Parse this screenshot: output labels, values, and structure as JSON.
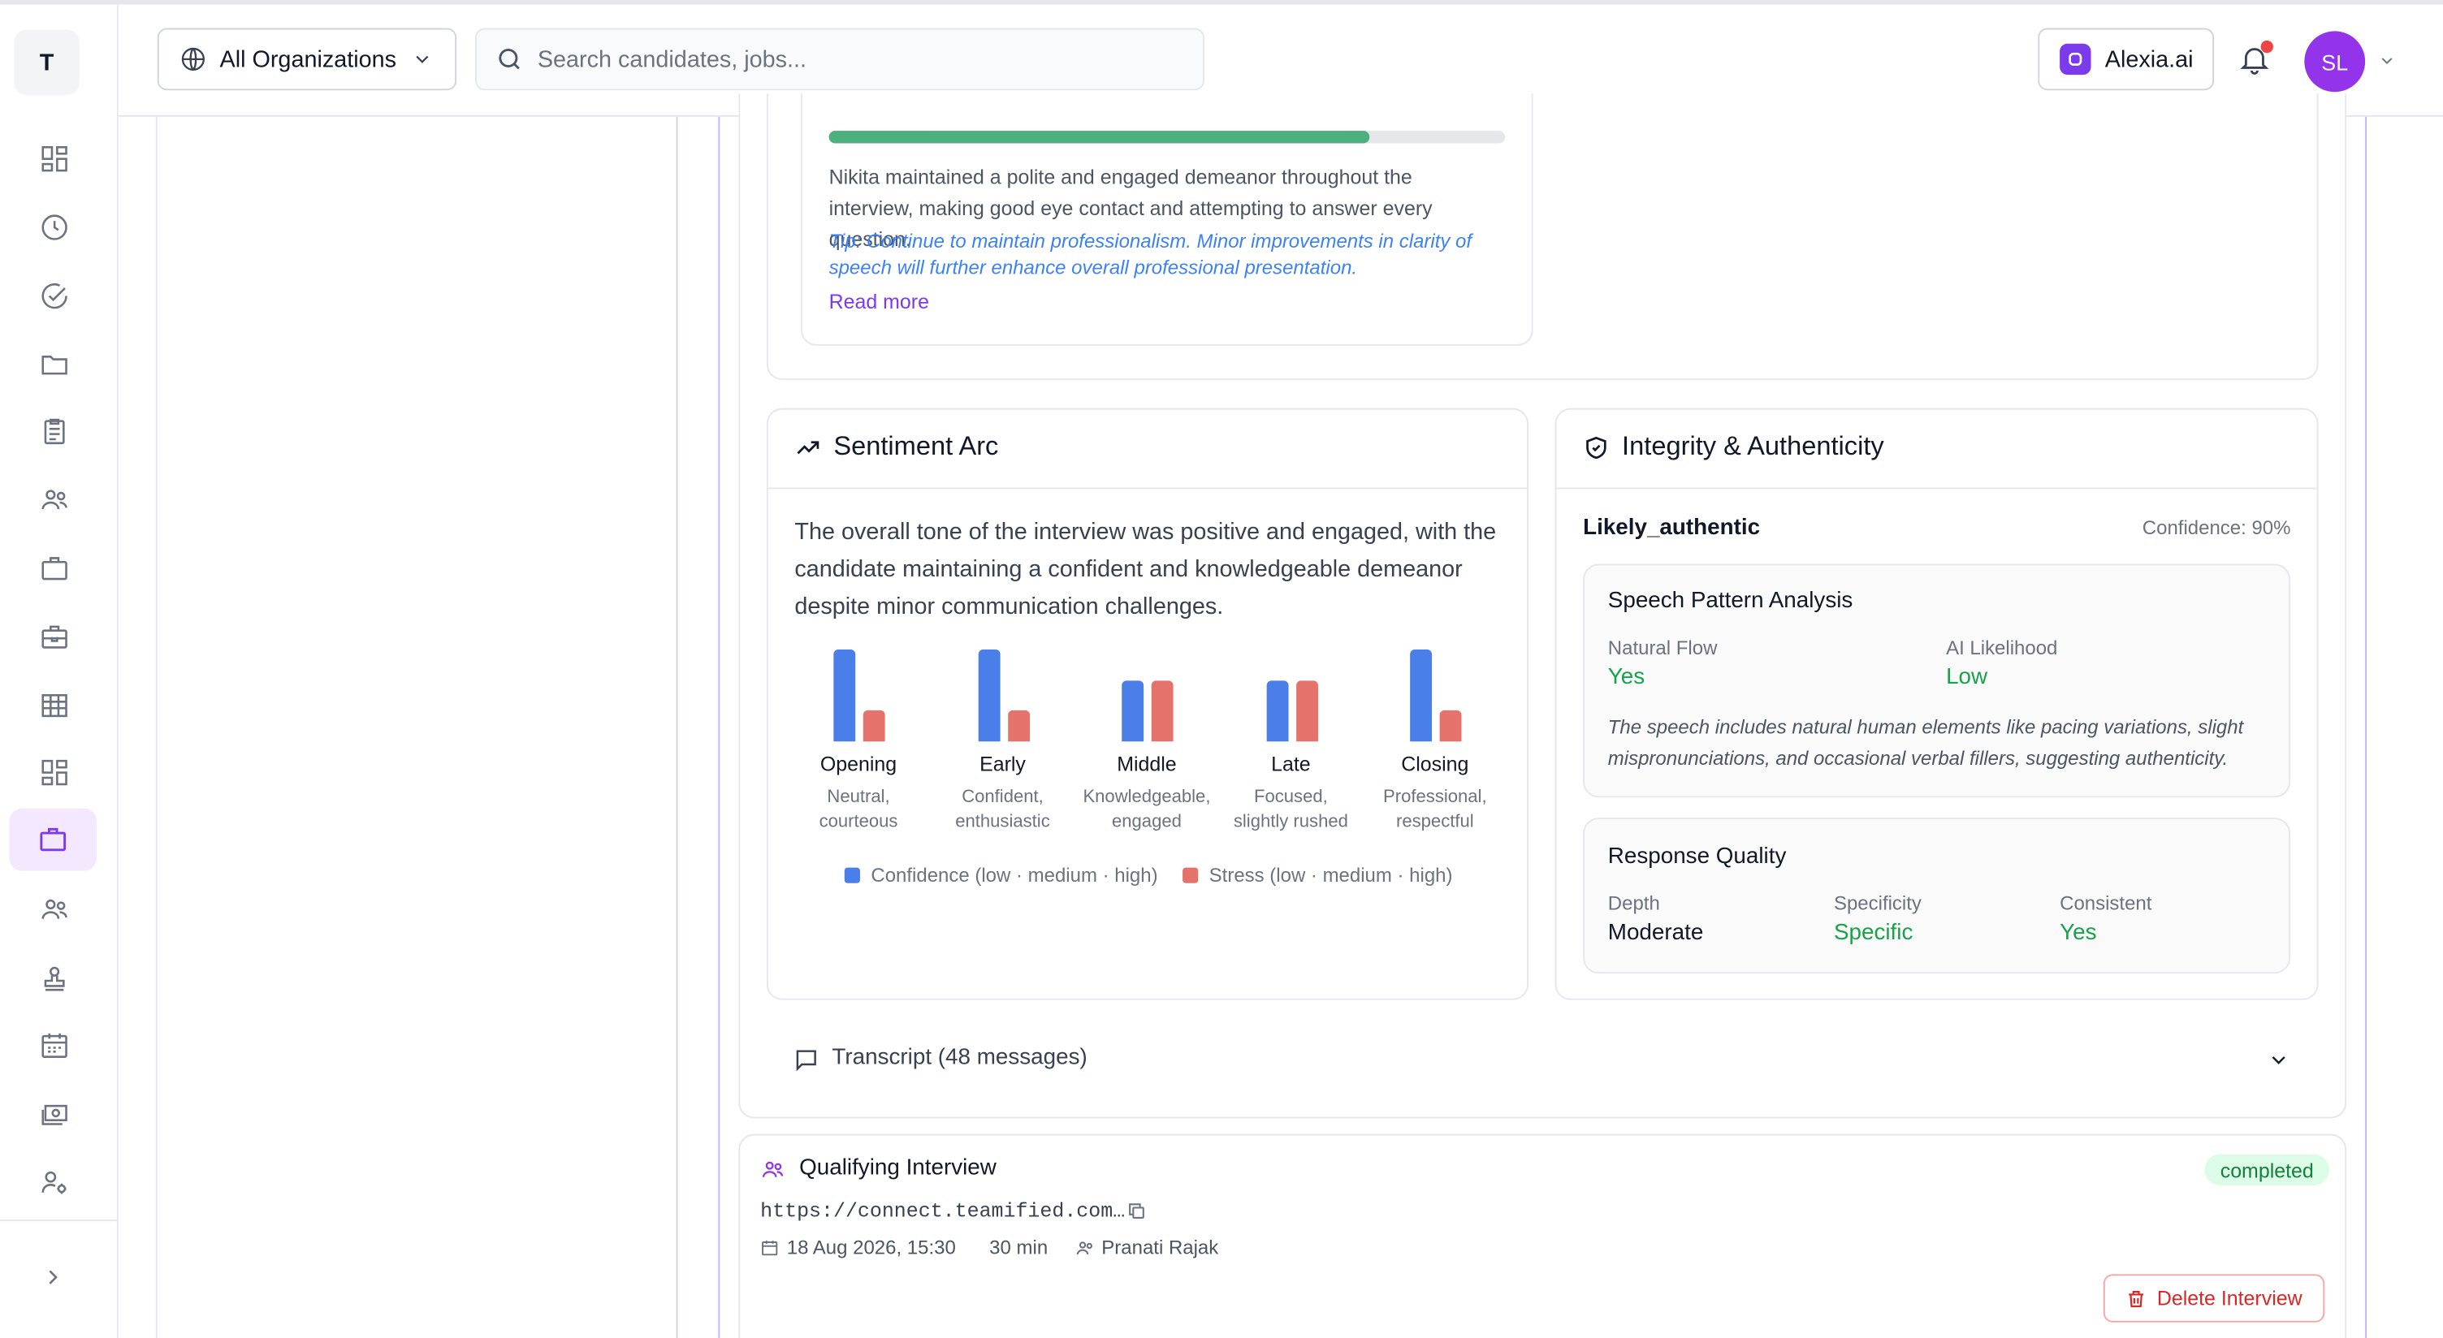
{
  "sidebar": {
    "logo_letter": "T",
    "items": [
      {
        "icon": "dashboard-icon"
      },
      {
        "icon": "clock-icon"
      },
      {
        "icon": "check-circle-icon"
      },
      {
        "icon": "folder-icon"
      },
      {
        "icon": "clipboard-icon"
      },
      {
        "icon": "users-icon"
      },
      {
        "icon": "briefcase-icon"
      },
      {
        "icon": "toolbox-icon"
      },
      {
        "icon": "table-icon"
      },
      {
        "icon": "grid-icon"
      },
      {
        "icon": "briefcase-active-icon",
        "active": true
      },
      {
        "icon": "team-icon"
      },
      {
        "icon": "stamp-icon"
      },
      {
        "icon": "calendar-icon"
      },
      {
        "icon": "money-icon"
      },
      {
        "icon": "user-settings-icon"
      }
    ],
    "expand_icon": "chevron-right-icon"
  },
  "header": {
    "org_selector": "All Organizations",
    "search_placeholder": "Search candidates, jobs...",
    "assistant_label": "Alexia.ai",
    "avatar_initials": "SL"
  },
  "professionalism": {
    "progress": 0.8,
    "summary": "Nikita maintained a polite and engaged demeanor throughout the interview, making good eye contact and attempting to answer every question.",
    "tip": "Tip: Continue to maintain professionalism. Minor improvements in clarity of speech will further enhance overall professional presentation.",
    "read_more": "Read more"
  },
  "sentiment_arc": {
    "title": "Sentiment Arc",
    "description": "The overall tone of the interview was positive and engaged, with the candidate maintaining a confident and knowledgeable demeanor despite minor communication challenges.",
    "phases": [
      {
        "name": "Opening",
        "desc1": "Neutral,",
        "desc2": "courteous",
        "confidence": "high",
        "stress": "low"
      },
      {
        "name": "Early",
        "desc1": "Confident,",
        "desc2": "enthusiastic",
        "confidence": "high",
        "stress": "low"
      },
      {
        "name": "Middle",
        "desc1": "Knowledgeable,",
        "desc2": "engaged",
        "confidence": "medium",
        "stress": "medium"
      },
      {
        "name": "Late",
        "desc1": "Focused,",
        "desc2": "slightly rushed",
        "confidence": "medium",
        "stress": "medium"
      },
      {
        "name": "Closing",
        "desc1": "Professional,",
        "desc2": "respectful",
        "confidence": "high",
        "stress": "low"
      }
    ],
    "legend_confidence": "Confidence (low · medium · high)",
    "legend_stress": "Stress (low · medium · high)",
    "colors": {
      "confidence": "#4a7ee8",
      "stress": "#e5736b"
    }
  },
  "integrity": {
    "title": "Integrity & Authenticity",
    "verdict": "Likely_authentic",
    "confidence": "Confidence: 90%",
    "speech_pattern": {
      "title": "Speech Pattern Analysis",
      "natural_flow_label": "Natural Flow",
      "natural_flow_value": "Yes",
      "ai_likelihood_label": "AI Likelihood",
      "ai_likelihood_value": "Low",
      "note": "The speech includes natural human elements like pacing variations, slight mispronunciations, and occasional verbal fillers, suggesting authenticity."
    },
    "response_quality": {
      "title": "Response Quality",
      "depth_label": "Depth",
      "depth_value": "Moderate",
      "specificity_label": "Specificity",
      "specificity_value": "Specific",
      "consistent_label": "Consistent",
      "consistent_value": "Yes"
    }
  },
  "transcript": {
    "label": "Transcript (48 messages)"
  },
  "qualifying_interview": {
    "title": "Qualifying Interview",
    "status": "completed",
    "link": "https://connect.teamified.com…",
    "date": "18 Aug 2026, 15:30",
    "duration": "30 min",
    "interviewer": "Pranati Rajak",
    "delete_label": "Delete Interview"
  }
}
